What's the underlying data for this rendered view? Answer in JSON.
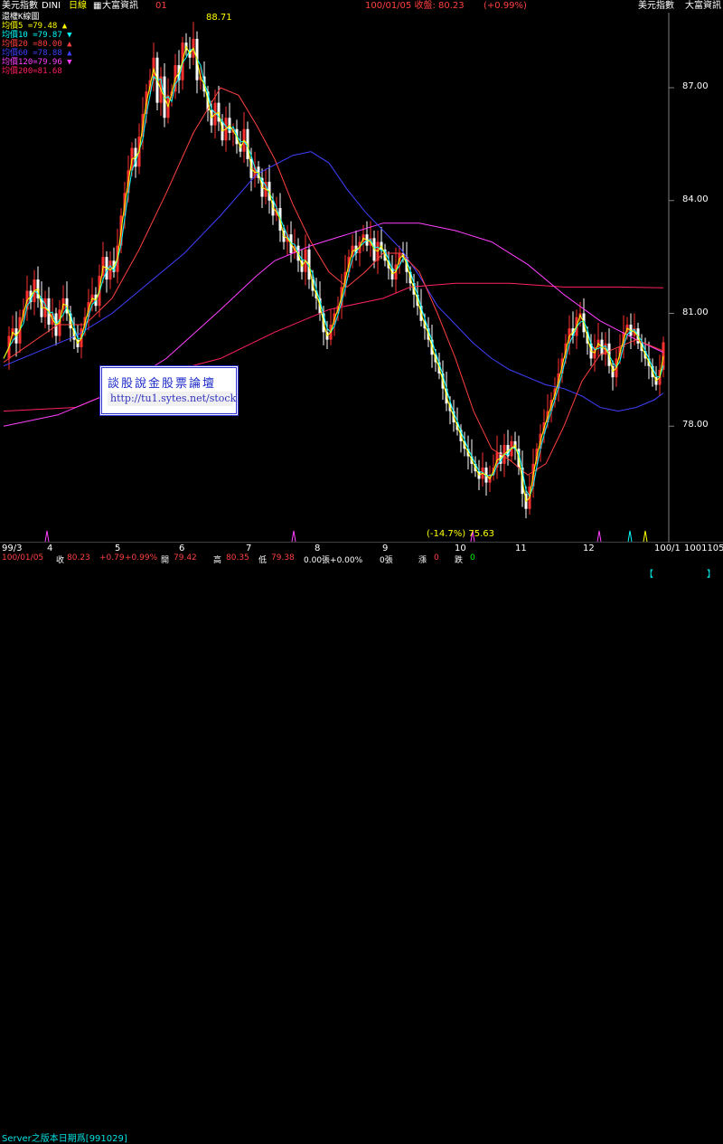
{
  "header": {
    "symbol": "美元指數",
    "code": "DINI",
    "period": "日線",
    "source_left": "大富資訊",
    "num": "01",
    "date_close": "100/01/05 收盤: 80.23",
    "change": "(+0.99%)",
    "right_symbol": "美元指數",
    "right_source": "大富資訊"
  },
  "legend": {
    "title": "還權K線圖",
    "lines": [
      {
        "label": "均價5  =79.48",
        "arrow": "▲",
        "color": "#ffff00"
      },
      {
        "label": "均價10 =79.87",
        "arrow": "▼",
        "color": "#00ffff"
      },
      {
        "label": "均價20 =80.00",
        "arrow": "▲",
        "color": "#ff4040"
      },
      {
        "label": "均價60 =78.88",
        "arrow": "▲",
        "color": "#4040ff"
      },
      {
        "label": "均價120=79.96",
        "arrow": "▼",
        "color": "#ff40ff"
      },
      {
        "label": "均價200=81.68",
        "arrow": "",
        "color": "#ff2060"
      }
    ]
  },
  "annotations": {
    "peak": "88.71",
    "low": "(-14.7%) 75.63"
  },
  "watermark": {
    "line1": "談股說金股票論壇",
    "line2": "http://tu1.sytes.net/stock"
  },
  "stats": {
    "date": "100/01/05",
    "close_label": "收",
    "close": "80.23",
    "change": "+0.79",
    "change_pct": "+0.99%",
    "open_label": "開",
    "open": "79.42",
    "high_label": "高",
    "high": "80.35",
    "low_label": "低",
    "low": "79.38",
    "vol": "0.00張+0.00%",
    "vol2": "0張",
    "up_label": "漲",
    "up": "0",
    "down_label": "跌",
    "down": "0"
  },
  "footer": {
    "server": "Server之版本日期爲[991029]",
    "right_bracket_1": "【",
    "right_bracket_2": "】"
  },
  "chart_data": {
    "type": "line",
    "title": "還權K線圖",
    "ylim": [
      75.0,
      88.9
    ],
    "yticks": [
      "87.00",
      "84.00",
      "81.00",
      "78.00"
    ],
    "xticks": [
      "99/3",
      "4",
      "5",
      "6",
      "7",
      "8",
      "9",
      "10",
      "11",
      "12",
      "100/1",
      "1001105"
    ],
    "grid": false,
    "close_path": [
      [
        0,
        79.8
      ],
      [
        6,
        80.4
      ],
      [
        10,
        80.6
      ],
      [
        14,
        80.2
      ],
      [
        18,
        80.9
      ],
      [
        22,
        81.1
      ],
      [
        26,
        81.6
      ],
      [
        30,
        81.3
      ],
      [
        34,
        81.9
      ],
      [
        38,
        81.4
      ],
      [
        42,
        80.9
      ],
      [
        46,
        81.4
      ],
      [
        50,
        80.7
      ],
      [
        54,
        81.0
      ],
      [
        58,
        80.4
      ],
      [
        62,
        81.1
      ],
      [
        66,
        81.4
      ],
      [
        70,
        81.0
      ],
      [
        74,
        80.6
      ],
      [
        78,
        80.3
      ],
      [
        82,
        80.1
      ],
      [
        86,
        80.6
      ],
      [
        90,
        80.9
      ],
      [
        94,
        81.3
      ],
      [
        98,
        81.5
      ],
      [
        102,
        81.2
      ],
      [
        106,
        82.0
      ],
      [
        110,
        82.5
      ],
      [
        114,
        81.9
      ],
      [
        118,
        82.4
      ],
      [
        122,
        82.1
      ],
      [
        126,
        82.8
      ],
      [
        130,
        83.6
      ],
      [
        134,
        84.2
      ],
      [
        138,
        84.8
      ],
      [
        142,
        85.4
      ],
      [
        146,
        84.9
      ],
      [
        150,
        85.7
      ],
      [
        154,
        86.3
      ],
      [
        158,
        86.9
      ],
      [
        162,
        87.2
      ],
      [
        166,
        87.8
      ],
      [
        170,
        86.6
      ],
      [
        174,
        87.3
      ],
      [
        178,
        86.2
      ],
      [
        182,
        86.8
      ],
      [
        186,
        86.9
      ],
      [
        190,
        87.6
      ],
      [
        194,
        87.2
      ],
      [
        198,
        88.2
      ],
      [
        202,
        88.0
      ],
      [
        206,
        87.8
      ],
      [
        210,
        88.3
      ],
      [
        214,
        87.2
      ],
      [
        218,
        87.3
      ],
      [
        222,
        86.9
      ],
      [
        226,
        86.4
      ],
      [
        230,
        86.0
      ],
      [
        234,
        86.6
      ],
      [
        238,
        86.1
      ],
      [
        242,
        85.6
      ],
      [
        246,
        86.2
      ],
      [
        250,
        85.8
      ],
      [
        254,
        85.9
      ],
      [
        258,
        85.5
      ],
      [
        262,
        85.3
      ],
      [
        266,
        85.9
      ],
      [
        270,
        85.1
      ],
      [
        274,
        84.6
      ],
      [
        278,
        84.9
      ],
      [
        282,
        84.6
      ],
      [
        286,
        84.1
      ],
      [
        290,
        84.5
      ],
      [
        294,
        84.0
      ],
      [
        298,
        83.6
      ],
      [
        302,
        83.8
      ],
      [
        306,
        83.2
      ],
      [
        310,
        82.9
      ],
      [
        314,
        83.1
      ],
      [
        318,
        82.6
      ],
      [
        322,
        82.8
      ],
      [
        326,
        82.4
      ],
      [
        330,
        82.1
      ],
      [
        334,
        82.7
      ],
      [
        338,
        81.9
      ],
      [
        342,
        81.6
      ],
      [
        346,
        81.4
      ],
      [
        350,
        81.0
      ],
      [
        354,
        80.5
      ],
      [
        358,
        80.3
      ],
      [
        362,
        80.7
      ],
      [
        366,
        81.0
      ],
      [
        370,
        81.2
      ],
      [
        374,
        81.7
      ],
      [
        378,
        82.1
      ],
      [
        382,
        82.5
      ],
      [
        386,
        82.8
      ],
      [
        390,
        82.6
      ],
      [
        394,
        82.9
      ],
      [
        398,
        83.1
      ],
      [
        402,
        82.8
      ],
      [
        406,
        83.0
      ],
      [
        410,
        82.4
      ],
      [
        414,
        82.9
      ],
      [
        418,
        82.7
      ],
      [
        422,
        82.4
      ],
      [
        426,
        82.2
      ],
      [
        430,
        81.9
      ],
      [
        434,
        82.3
      ],
      [
        438,
        82.6
      ],
      [
        442,
        82.5
      ],
      [
        446,
        82.1
      ],
      [
        450,
        81.8
      ],
      [
        454,
        81.5
      ],
      [
        458,
        81.2
      ],
      [
        462,
        80.8
      ],
      [
        466,
        80.6
      ],
      [
        470,
        80.3
      ],
      [
        474,
        79.9
      ],
      [
        478,
        79.7
      ],
      [
        482,
        79.4
      ],
      [
        486,
        79.0
      ],
      [
        490,
        78.6
      ],
      [
        494,
        78.4
      ],
      [
        498,
        78.1
      ],
      [
        502,
        77.9
      ],
      [
        506,
        77.6
      ],
      [
        510,
        77.4
      ],
      [
        514,
        77.2
      ],
      [
        518,
        77.0
      ],
      [
        522,
        76.8
      ],
      [
        526,
        76.6
      ],
      [
        530,
        76.9
      ],
      [
        534,
        76.5
      ],
      [
        538,
        76.7
      ],
      [
        542,
        76.9
      ],
      [
        546,
        77.3
      ],
      [
        550,
        77.0
      ],
      [
        554,
        77.5
      ],
      [
        558,
        77.2
      ],
      [
        562,
        77.6
      ],
      [
        566,
        77.4
      ],
      [
        570,
        76.9
      ],
      [
        574,
        76.2
      ],
      [
        578,
        75.8
      ],
      [
        582,
        76.4
      ],
      [
        586,
        77.0
      ],
      [
        590,
        77.4
      ],
      [
        594,
        77.8
      ],
      [
        598,
        78.1
      ],
      [
        602,
        78.4
      ],
      [
        606,
        78.7
      ],
      [
        610,
        79.0
      ],
      [
        614,
        79.4
      ],
      [
        618,
        79.8
      ],
      [
        622,
        80.2
      ],
      [
        626,
        80.6
      ],
      [
        630,
        80.4
      ],
      [
        634,
        80.9
      ],
      [
        638,
        81.0
      ],
      [
        642,
        80.5
      ],
      [
        646,
        80.2
      ],
      [
        650,
        79.8
      ],
      [
        654,
        80.1
      ],
      [
        658,
        80.3
      ],
      [
        662,
        79.9
      ],
      [
        666,
        80.2
      ],
      [
        670,
        79.6
      ],
      [
        674,
        79.3
      ],
      [
        678,
        79.8
      ],
      [
        682,
        80.1
      ],
      [
        686,
        80.5
      ],
      [
        690,
        80.7
      ],
      [
        694,
        80.4
      ],
      [
        698,
        80.6
      ],
      [
        702,
        80.2
      ],
      [
        706,
        80.0
      ],
      [
        710,
        79.8
      ],
      [
        714,
        79.6
      ],
      [
        718,
        79.3
      ],
      [
        722,
        79.1
      ],
      [
        726,
        79.5
      ],
      [
        730,
        80.23
      ]
    ],
    "series": [
      {
        "name": "均價5",
        "color": "#ffff00"
      },
      {
        "name": "均價10",
        "color": "#00ffff"
      },
      {
        "name": "均價20",
        "color": "#ff4040"
      },
      {
        "name": "均價60",
        "color": "#4040ff"
      },
      {
        "name": "均價120",
        "color": "#ff40ff"
      },
      {
        "name": "均價200",
        "color": "#ff2060"
      }
    ],
    "ma60_path": [
      [
        0,
        79.6
      ],
      [
        40,
        80.0
      ],
      [
        80,
        80.4
      ],
      [
        120,
        81.0
      ],
      [
        160,
        81.8
      ],
      [
        200,
        82.6
      ],
      [
        240,
        83.6
      ],
      [
        280,
        84.7
      ],
      [
        320,
        85.2
      ],
      [
        340,
        85.3
      ],
      [
        360,
        85.0
      ],
      [
        380,
        84.3
      ],
      [
        400,
        83.7
      ],
      [
        420,
        83.2
      ],
      [
        440,
        82.7
      ],
      [
        460,
        82.0
      ],
      [
        480,
        81.2
      ],
      [
        500,
        80.7
      ],
      [
        520,
        80.2
      ],
      [
        540,
        79.8
      ],
      [
        560,
        79.5
      ],
      [
        580,
        79.3
      ],
      [
        600,
        79.1
      ],
      [
        620,
        79.0
      ],
      [
        640,
        78.8
      ],
      [
        660,
        78.5
      ],
      [
        680,
        78.4
      ],
      [
        700,
        78.5
      ],
      [
        720,
        78.7
      ],
      [
        730,
        78.88
      ]
    ],
    "ma120_path": [
      [
        0,
        78.0
      ],
      [
        60,
        78.3
      ],
      [
        120,
        78.9
      ],
      [
        180,
        79.8
      ],
      [
        240,
        81.1
      ],
      [
        280,
        82.0
      ],
      [
        300,
        82.4
      ],
      [
        340,
        82.8
      ],
      [
        380,
        83.1
      ],
      [
        420,
        83.4
      ],
      [
        460,
        83.4
      ],
      [
        500,
        83.2
      ],
      [
        540,
        82.9
      ],
      [
        580,
        82.3
      ],
      [
        620,
        81.5
      ],
      [
        660,
        80.8
      ],
      [
        700,
        80.3
      ],
      [
        730,
        79.96
      ]
    ],
    "ma200_path": [
      [
        0,
        78.4
      ],
      [
        80,
        78.5
      ],
      [
        160,
        79.3
      ],
      [
        240,
        79.8
      ],
      [
        300,
        80.5
      ],
      [
        360,
        81.1
      ],
      [
        420,
        81.4
      ],
      [
        450,
        81.7
      ],
      [
        500,
        81.8
      ],
      [
        560,
        81.8
      ],
      [
        620,
        81.7
      ],
      [
        680,
        81.7
      ],
      [
        730,
        81.68
      ]
    ],
    "ma20_path": [
      [
        0,
        79.7
      ],
      [
        30,
        80.2
      ],
      [
        60,
        80.7
      ],
      [
        90,
        80.7
      ],
      [
        120,
        81.4
      ],
      [
        150,
        82.7
      ],
      [
        180,
        84.2
      ],
      [
        210,
        85.8
      ],
      [
        240,
        87.0
      ],
      [
        260,
        86.8
      ],
      [
        280,
        86.0
      ],
      [
        300,
        85.1
      ],
      [
        320,
        83.9
      ],
      [
        340,
        82.9
      ],
      [
        360,
        82.1
      ],
      [
        380,
        81.7
      ],
      [
        400,
        82.1
      ],
      [
        420,
        82.6
      ],
      [
        440,
        82.6
      ],
      [
        460,
        82.1
      ],
      [
        480,
        81.0
      ],
      [
        500,
        79.8
      ],
      [
        520,
        78.4
      ],
      [
        540,
        77.4
      ],
      [
        560,
        77.1
      ],
      [
        580,
        76.7
      ],
      [
        600,
        77.0
      ],
      [
        620,
        78.0
      ],
      [
        640,
        79.2
      ],
      [
        660,
        79.9
      ],
      [
        680,
        80.1
      ],
      [
        700,
        80.3
      ],
      [
        720,
        80.1
      ],
      [
        730,
        80.0
      ]
    ]
  }
}
